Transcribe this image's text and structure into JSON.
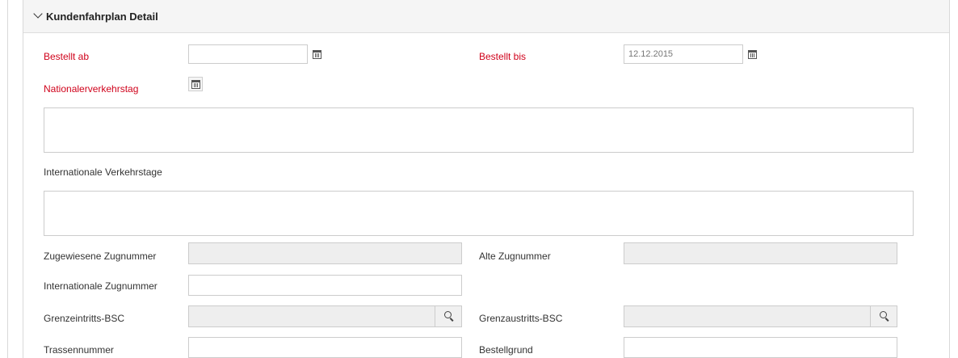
{
  "section": {
    "title": "Kundenfahrplan Detail"
  },
  "fields": {
    "bestellt_ab": {
      "label": "Bestellt ab",
      "value": ""
    },
    "bestellt_bis": {
      "label": "Bestellt bis",
      "value": "12.12.2015"
    },
    "national": {
      "label": "Nationalerverkehrstag"
    },
    "international": {
      "label": "Internationale Verkehrstage"
    },
    "zugewiesene": {
      "label": "Zugewiesene Zugnummer",
      "value": ""
    },
    "alte": {
      "label": "Alte Zugnummer",
      "value": ""
    },
    "internationale_zug": {
      "label": "Internationale Zugnummer",
      "value": ""
    },
    "grenzeintritt": {
      "label": "Grenzeintritts-BSC",
      "value": ""
    },
    "grenzaustritt": {
      "label": "Grenzaustritts-BSC",
      "value": ""
    },
    "trassennummer": {
      "label": "Trassennummer",
      "value": ""
    },
    "bestellgrund": {
      "label": "Bestellgrund",
      "value": ""
    }
  },
  "colors": {
    "required": "#d0021b",
    "readonly_bg": "#eeeeee",
    "header_bg": "#f5f5f5"
  },
  "icons": {
    "collapse": "chevron-down-icon",
    "date": "calendar-icon",
    "lookup": "search-icon"
  }
}
